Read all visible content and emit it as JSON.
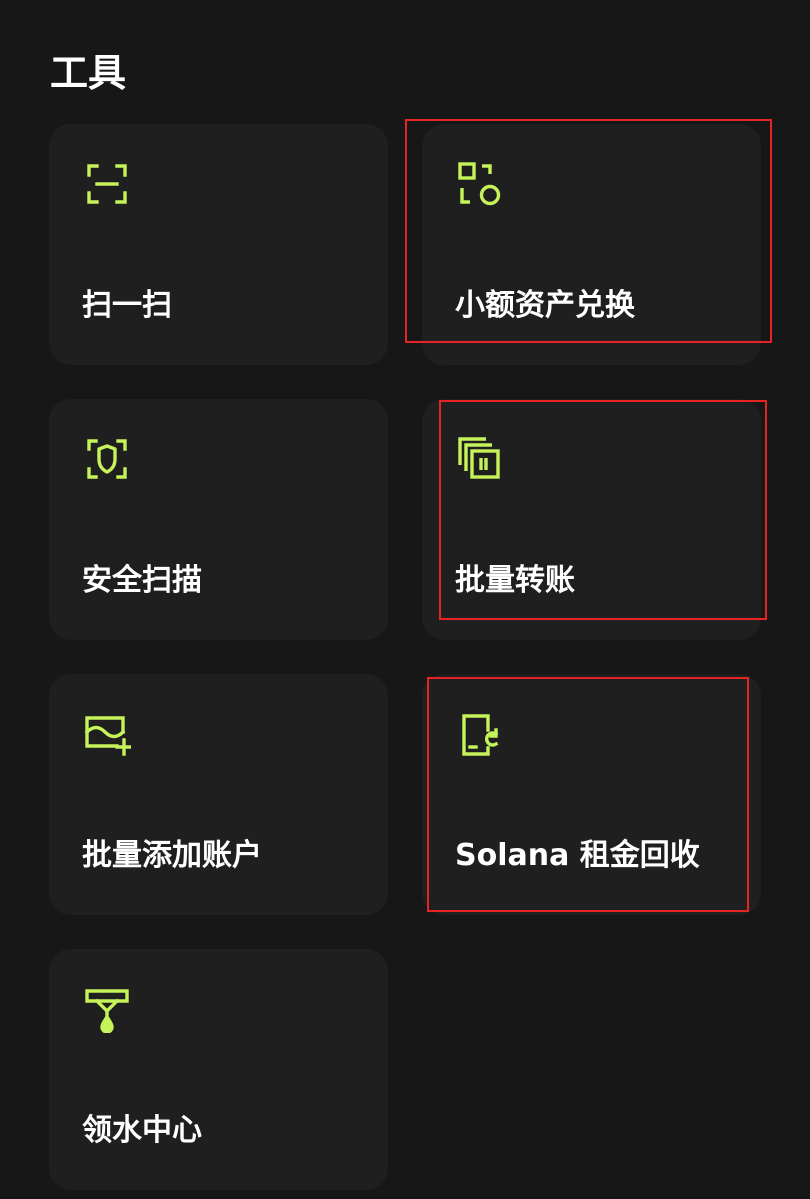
{
  "section": {
    "title": "工具"
  },
  "accent_color": "#c6f25a",
  "highlight_color": "#e62424",
  "tools": [
    {
      "label": "扫一扫",
      "icon": "scan-icon"
    },
    {
      "label": "小额资产兑换",
      "icon": "small-asset-swap-icon"
    },
    {
      "label": "安全扫描",
      "icon": "security-scan-icon"
    },
    {
      "label": "批量转账",
      "icon": "batch-transfer-icon"
    },
    {
      "label": "批量添加账户",
      "icon": "add-wallet-icon"
    },
    {
      "label": "Solana 租金回收",
      "icon": "rent-reclaim-icon"
    },
    {
      "label": "领水中心",
      "icon": "faucet-icon"
    }
  ]
}
